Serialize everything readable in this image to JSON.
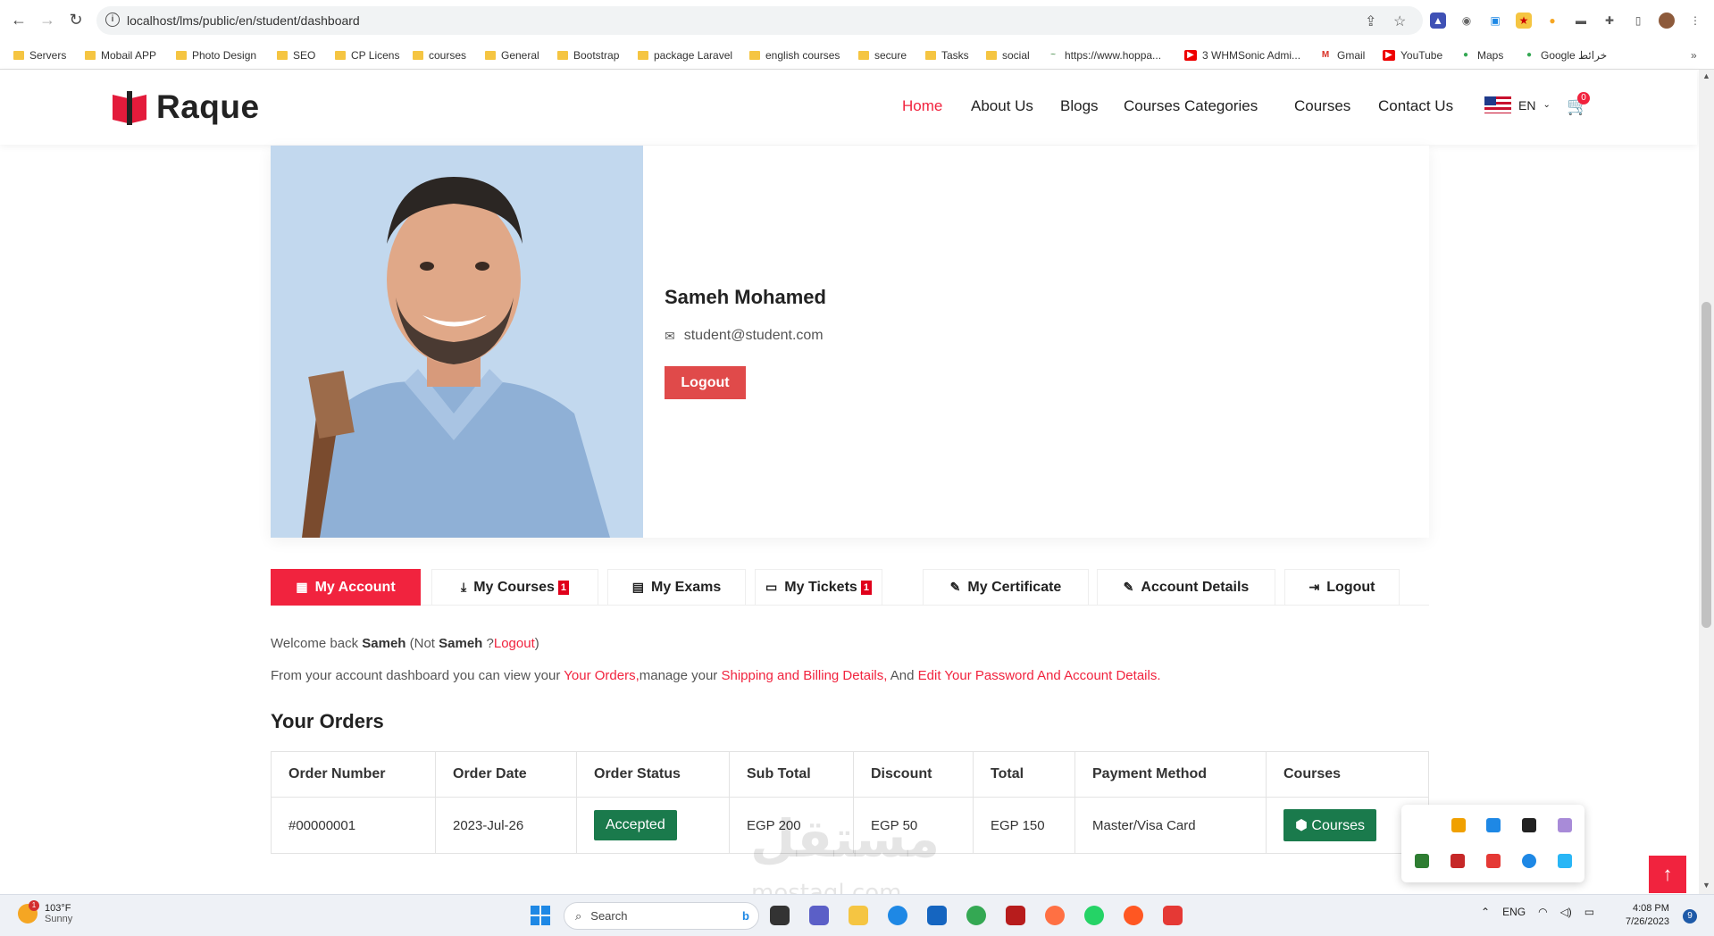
{
  "browser": {
    "url": "localhost/lms/public/en/student/dashboard",
    "bookmarks": [
      "Servers",
      "Mobail APP",
      "Photo Design",
      "SEO",
      "CP Licens",
      "courses",
      "General",
      "Bootstrap",
      "package Laravel",
      "english courses",
      "secure",
      "Tasks",
      "social",
      "https://www.hoppa...",
      "3 WHMSonic Admi...",
      "Gmail",
      "YouTube",
      "Maps",
      "Google خرائط"
    ]
  },
  "site": {
    "logo_text": "Raque",
    "nav": [
      "Home",
      "About Us",
      "Blogs",
      "Courses Categories",
      "Courses",
      "Contact Us"
    ],
    "active_nav": "Home",
    "language": "EN",
    "cart_count": "0",
    "accent_color": "#f1233e"
  },
  "profile": {
    "name": "Sameh Mohamed",
    "email": "student@student.com",
    "logout_label": "Logout"
  },
  "tabs": [
    {
      "label": "My Account",
      "icon": "dashboard-icon",
      "active": true
    },
    {
      "label": "My Courses",
      "icon": "download-icon",
      "badge": "1"
    },
    {
      "label": "My Exams",
      "icon": "book-icon"
    },
    {
      "label": "My Tickets",
      "icon": "ticket-icon",
      "badge": "1"
    },
    {
      "label": "My Certificate",
      "icon": "edit-icon"
    },
    {
      "label": "Account Details",
      "icon": "edit-icon"
    },
    {
      "label": "Logout",
      "icon": "logout-icon"
    }
  ],
  "dashboard": {
    "welcome_prefix": "Welcome back",
    "welcome_name": "Sameh",
    "welcome_not": "(Not",
    "welcome_name2": "Sameh",
    "welcome_q": "?",
    "welcome_logout": "Logout",
    "welcome_close": ")",
    "intro_1": "From your account dashboard you can view your",
    "intro_link1": "Your Orders,",
    "intro_2": "manage your",
    "intro_link2": "Shipping and Billing Details,",
    "intro_3": "And",
    "intro_link3": "Edit Your Password And Account Details.",
    "orders_title": "Your Orders"
  },
  "orders": {
    "headers": [
      "Order Number",
      "Order Date",
      "Order Status",
      "Sub Total",
      "Discount",
      "Total",
      "Payment Method",
      "Courses"
    ],
    "rows": [
      {
        "number": "#00000001",
        "date": "2023-Jul-26",
        "status": "Accepted",
        "subtotal": "EGP 200",
        "discount": "EGP 50",
        "total": "EGP 150",
        "payment": "Master/Visa Card",
        "courses_label": "Courses"
      }
    ]
  },
  "taskbar": {
    "temperature": "103°F",
    "weather": "Sunny",
    "weather_badge": "1",
    "search_placeholder": "Search",
    "language": "ENG",
    "time": "4:08 PM",
    "date": "7/26/2023",
    "notifications": "9"
  },
  "watermark": {
    "text": "مستقل",
    "sub": "mostaql.com"
  }
}
